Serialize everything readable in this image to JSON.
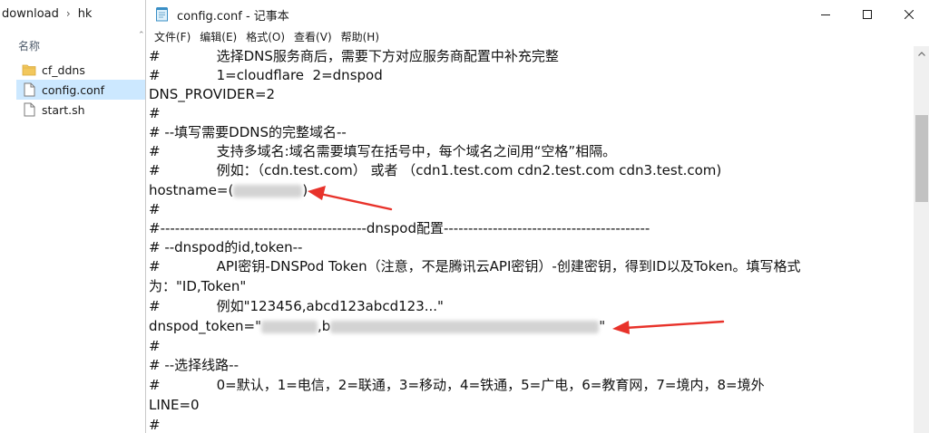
{
  "explorer": {
    "breadcrumb": [
      "download",
      "hk"
    ],
    "column_header": "名称",
    "files": [
      {
        "name": "cf_ddns",
        "icon": "folder-icon",
        "selected": false
      },
      {
        "name": "config.conf",
        "icon": "file-icon",
        "selected": true
      },
      {
        "name": "start.sh",
        "icon": "file-icon",
        "selected": false
      }
    ]
  },
  "notepad": {
    "title": "config.conf - 记事本",
    "menu": [
      "文件(F)",
      "编辑(E)",
      "格式(O)",
      "查看(V)",
      "帮助(H)"
    ],
    "lines": {
      "l1": "选择DNS服务商后，需要下方对应服务商配置中补充完整",
      "l2": "1=cloudflare  2=dnspod",
      "l3": "DNS_PROVIDER=2",
      "l4": "#",
      "l5": "# --填写需要DDNS的完整域名--",
      "l6": "支持多域名:域名需要填写在括号中，每个域名之间用“空格”相隔。",
      "l7": "例如：（cdn.test.com） 或者 （cdn1.test.com cdn2.test.com cdn3.test.com)",
      "l8_prefix": "hostname=(",
      "l8_suffix": ")",
      "l9": "#",
      "l10": "#------------------------------------------dnspod配置------------------------------------------",
      "l11": "# --dnspod的id,token--",
      "l12": "API密钥-DNSPod Token（注意，不是腾讯云API密钥）-创建密钥，得到ID以及Token。填写格式",
      "l13": "为：\"ID,Token\"",
      "l14": "例如\"123456,abcd123abcd123...\"",
      "l15_prefix": "dnspod_token=\"",
      "l15_mid": ",b",
      "l15_suffix": "\"",
      "l16": "#",
      "l17": "# --选择线路--",
      "l18": "0=默认，1=电信，2=联通，3=移动，4=铁通，5=广电，6=教育网，7=境内，8=境外",
      "l19": "LINE=0",
      "l20": "#",
      "hash": "#"
    }
  },
  "colors": {
    "selection": "#cce8ff",
    "arrow": "#e8322a",
    "scrollbar_track": "#f0f0f0",
    "scrollbar_thumb": "#c2c2c2"
  }
}
